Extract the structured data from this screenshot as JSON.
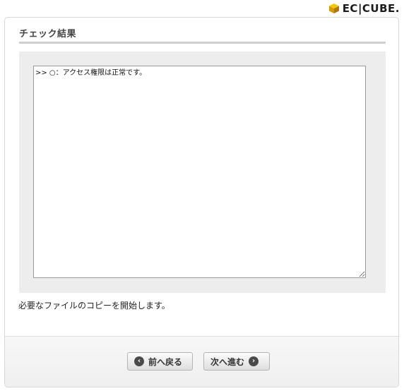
{
  "logo": {
    "text": "EC|CUBE.",
    "icon": "cube-icon"
  },
  "panel": {
    "title": "チェック結果",
    "result_text": ">> ○：アクセス権限は正常です。",
    "message": "必要なファイルのコピーを開始します。"
  },
  "buttons": {
    "back_label": "前へ戻る",
    "back_icon": "chevron-left-icon",
    "next_label": "次へ進む",
    "next_icon": "chevron-right-icon"
  },
  "colors": {
    "logo_accent": "#f0b400",
    "box_bg": "#ededed",
    "button_icon": "#4a4a4a"
  }
}
